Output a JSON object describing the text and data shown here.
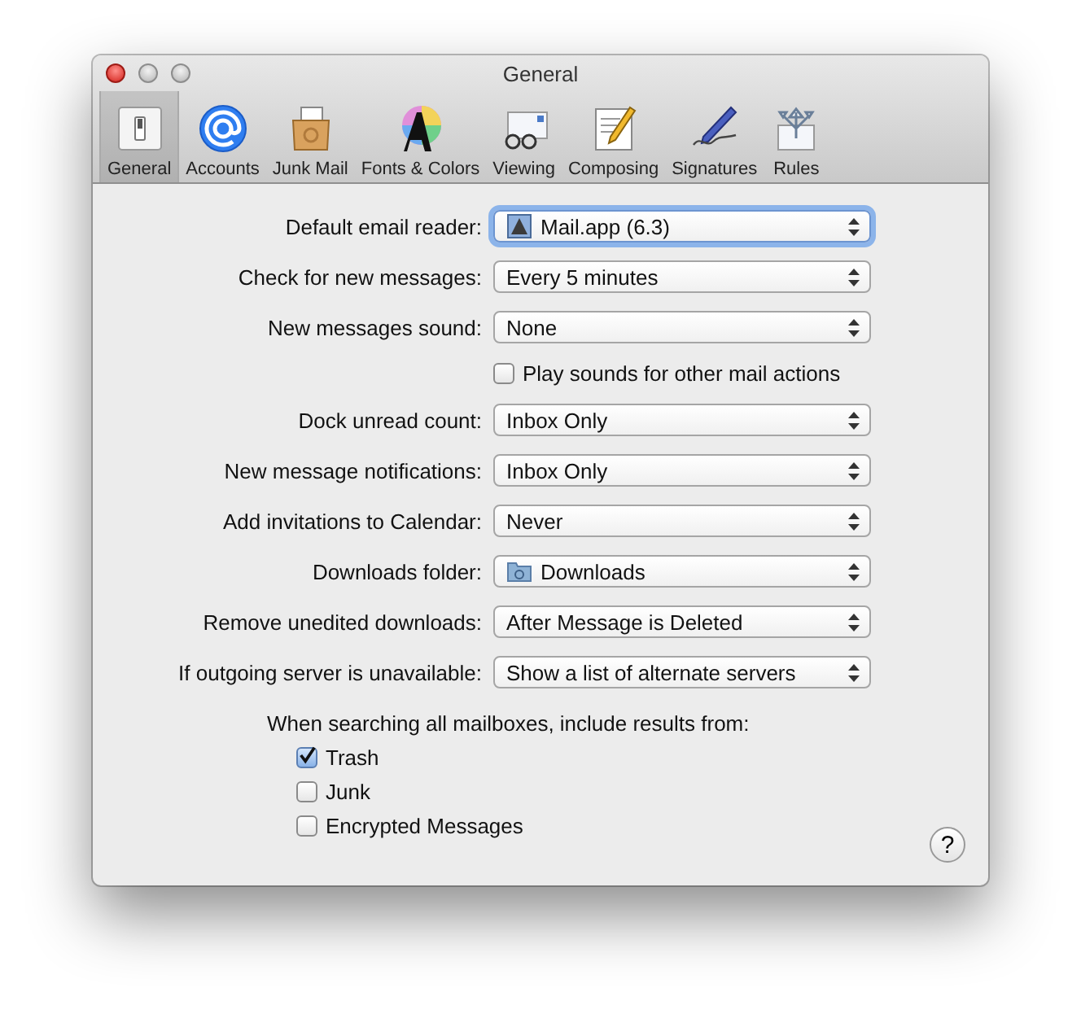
{
  "window": {
    "title": "General"
  },
  "toolbar": [
    {
      "label": "General",
      "selected": true
    },
    {
      "label": "Accounts",
      "selected": false
    },
    {
      "label": "Junk Mail",
      "selected": false
    },
    {
      "label": "Fonts & Colors",
      "selected": false
    },
    {
      "label": "Viewing",
      "selected": false
    },
    {
      "label": "Composing",
      "selected": false
    },
    {
      "label": "Signatures",
      "selected": false
    },
    {
      "label": "Rules",
      "selected": false
    }
  ],
  "rows": [
    {
      "kind": "app_popup",
      "label": "Default email reader:",
      "value": "Mail.app (6.3)",
      "focused": true
    },
    {
      "kind": "popup",
      "label": "Check for new messages:",
      "value": "Every 5 minutes",
      "focused": false
    },
    {
      "kind": "popup",
      "label": "New messages sound:",
      "value": "None",
      "focused": false
    },
    {
      "kind": "checkbox",
      "label": "Play sounds for other mail actions",
      "checked": false
    },
    {
      "kind": "popup",
      "label": "Dock unread count:",
      "value": "Inbox Only",
      "focused": false
    },
    {
      "kind": "popup",
      "label": "New message notifications:",
      "value": "Inbox Only",
      "focused": false
    },
    {
      "kind": "popup",
      "label": "Add invitations to Calendar:",
      "value": "Never",
      "focused": false
    },
    {
      "kind": "folder_popup",
      "label": "Downloads folder:",
      "value": "Downloads",
      "focused": false
    },
    {
      "kind": "popup",
      "label": "Remove unedited downloads:",
      "value": "After Message is Deleted",
      "focused": false
    },
    {
      "kind": "popup",
      "label": "If outgoing server is unavailable:",
      "value": "Show a list of alternate servers",
      "focused": false
    }
  ],
  "search": {
    "label": "When searching all mailboxes, include results from:",
    "options": [
      {
        "label": "Trash",
        "checked": true
      },
      {
        "label": "Junk",
        "checked": false
      },
      {
        "label": "Encrypted Messages",
        "checked": false
      }
    ]
  },
  "help_button": "?"
}
